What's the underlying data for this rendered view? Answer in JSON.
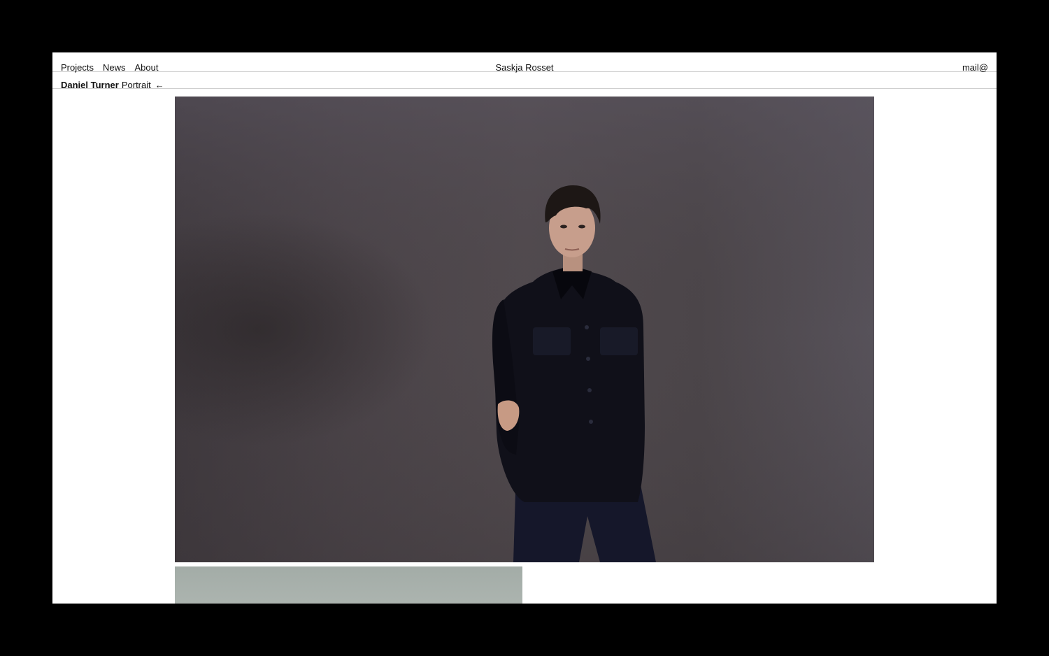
{
  "nav": {
    "links": [
      "Projects",
      "News",
      "About"
    ],
    "site_title": "Saskja Rosset",
    "mail": "mail@"
  },
  "project": {
    "client": "Daniel Turner",
    "category": "Portrait",
    "back_arrow": "←"
  },
  "colors": {
    "background": "#000000",
    "page": "#ffffff",
    "text": "#111111",
    "rule": "#cfcfcf",
    "wall": "#4a4447",
    "shirt": "#101019",
    "second_photo": "#a8b0ab"
  },
  "images": [
    {
      "subject": "portrait of man in dark shirt against grey wall"
    },
    {
      "subject": "pale green-grey photo (partially visible)"
    }
  ]
}
